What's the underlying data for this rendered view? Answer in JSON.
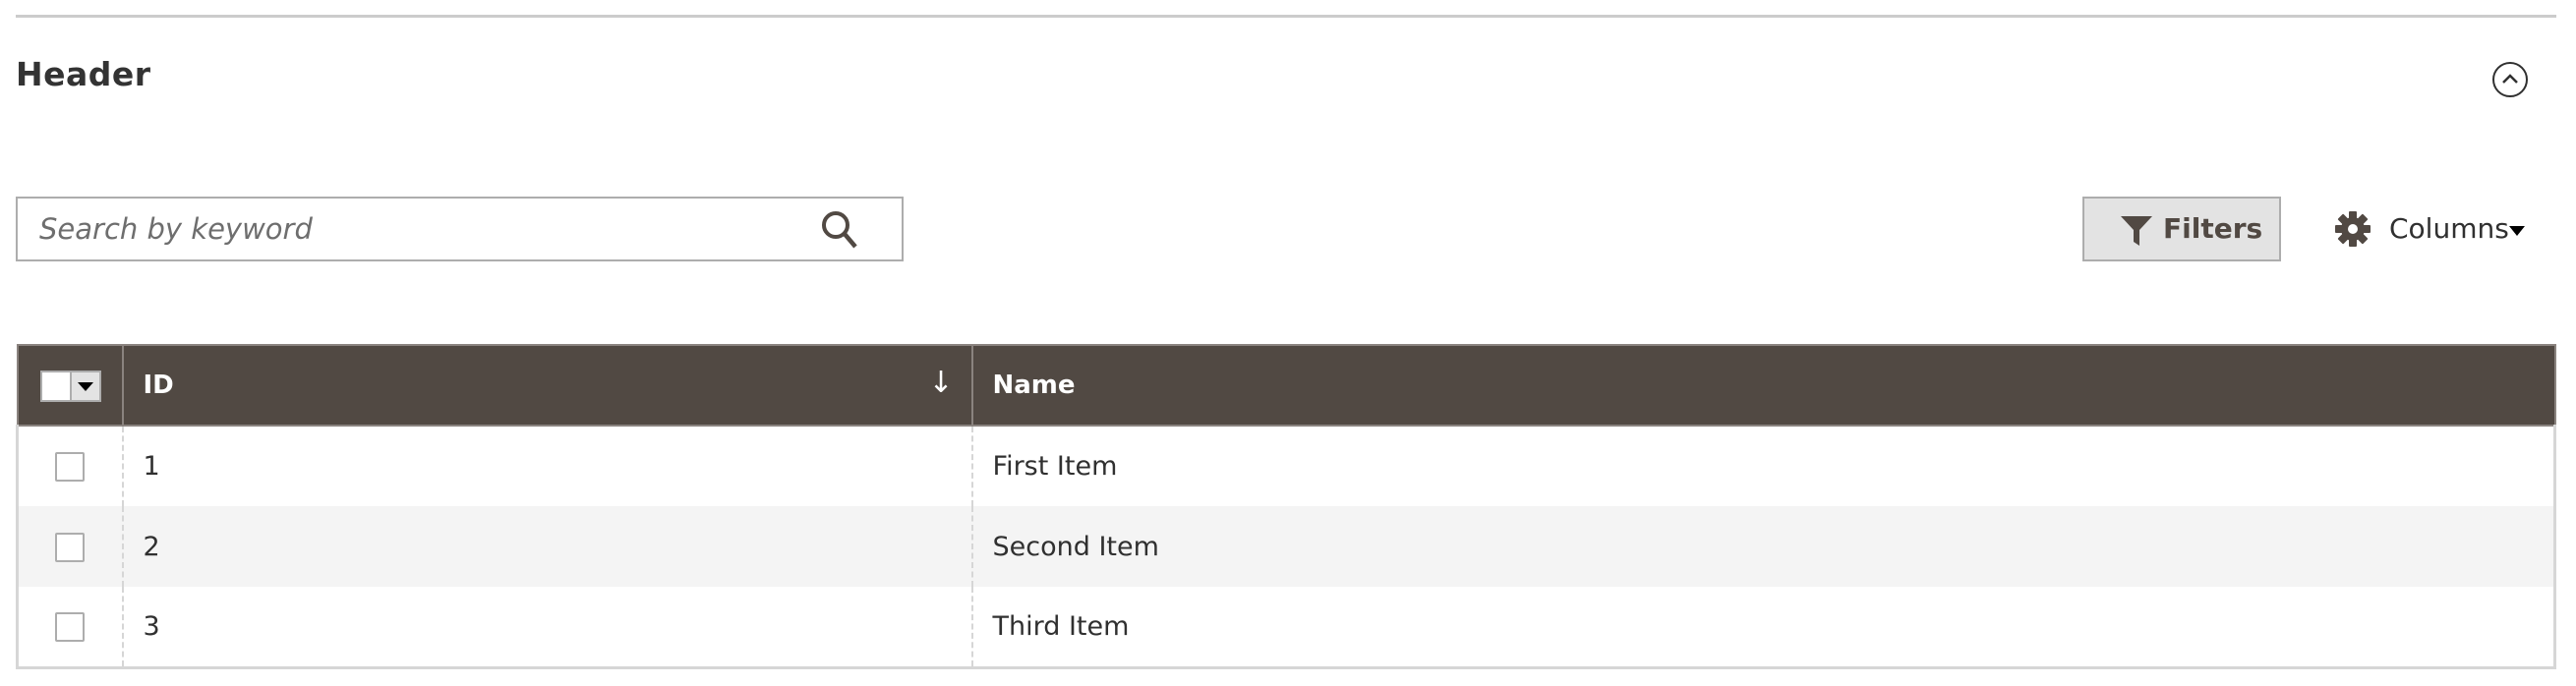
{
  "section": {
    "title": "Header",
    "collapse_icon": "chevron-up-circle-icon"
  },
  "toolbar": {
    "search": {
      "placeholder": "Search by keyword",
      "value": "",
      "icon": "search-icon"
    },
    "filters": {
      "label": "Filters",
      "icon": "funnel-icon"
    },
    "columns": {
      "label": "Columns",
      "icon": "gear-icon",
      "caret": "caret-down-icon"
    }
  },
  "grid": {
    "header_color": "#514943",
    "columns": [
      {
        "key": "select",
        "label": ""
      },
      {
        "key": "id",
        "label": "ID",
        "sort_indicator": "↓"
      },
      {
        "key": "name",
        "label": "Name"
      }
    ],
    "rows": [
      {
        "id": "1",
        "name": "First Item",
        "checked": false
      },
      {
        "id": "2",
        "name": "Second Item",
        "checked": false
      },
      {
        "id": "3",
        "name": "Third Item",
        "checked": false
      }
    ]
  }
}
